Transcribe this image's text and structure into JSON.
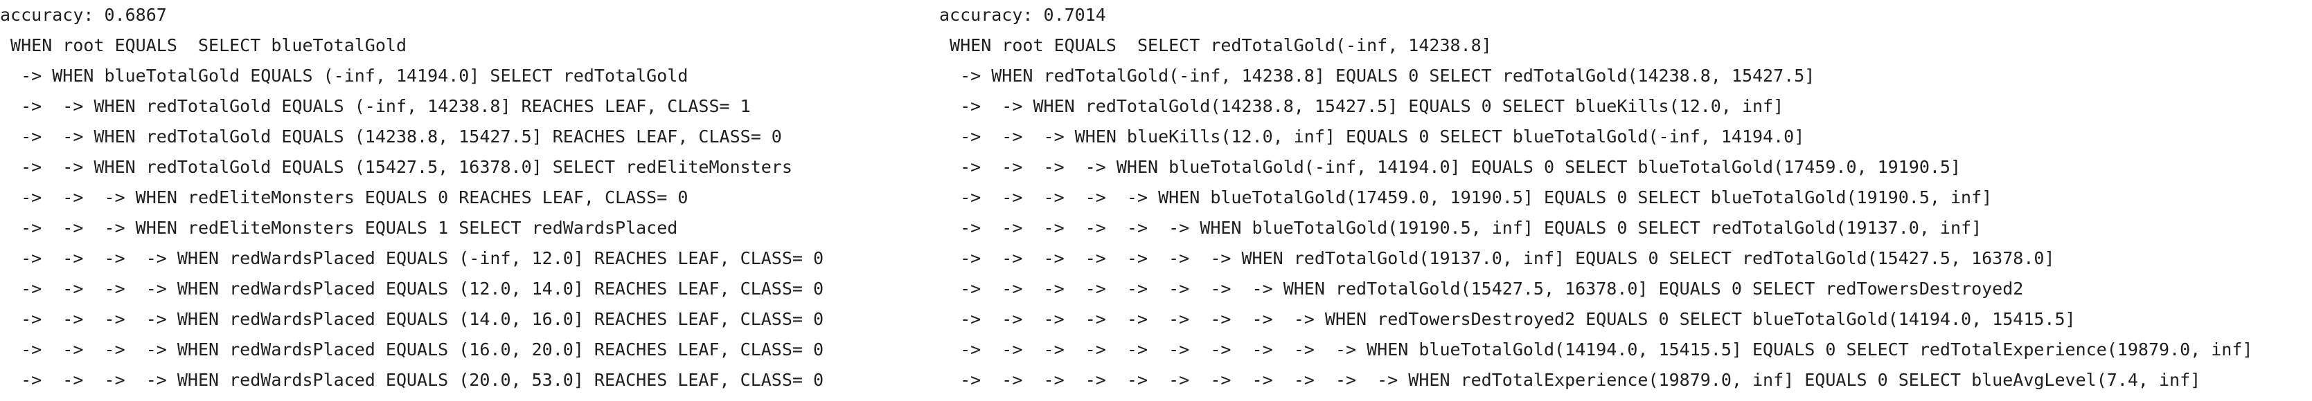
{
  "left_panel": {
    "accuracy": "accuracy: 0.6867",
    "lines": [
      " WHEN root EQUALS  SELECT blueTotalGold",
      "  -> WHEN blueTotalGold EQUALS (-inf, 14194.0] SELECT redTotalGold",
      "  ->  -> WHEN redTotalGold EQUALS (-inf, 14238.8] REACHES LEAF, CLASS= 1",
      "  ->  -> WHEN redTotalGold EQUALS (14238.8, 15427.5] REACHES LEAF, CLASS= 0",
      "  ->  -> WHEN redTotalGold EQUALS (15427.5, 16378.0] SELECT redEliteMonsters",
      "  ->  ->  -> WHEN redEliteMonsters EQUALS 0 REACHES LEAF, CLASS= 0",
      "  ->  ->  -> WHEN redEliteMonsters EQUALS 1 SELECT redWardsPlaced",
      "  ->  ->  ->  -> WHEN redWardsPlaced EQUALS (-inf, 12.0] REACHES LEAF, CLASS= 0",
      "  ->  ->  ->  -> WHEN redWardsPlaced EQUALS (12.0, 14.0] REACHES LEAF, CLASS= 0",
      "  ->  ->  ->  -> WHEN redWardsPlaced EQUALS (14.0, 16.0] REACHES LEAF, CLASS= 0",
      "  ->  ->  ->  -> WHEN redWardsPlaced EQUALS (16.0, 20.0] REACHES LEAF, CLASS= 0",
      "  ->  ->  ->  -> WHEN redWardsPlaced EQUALS (20.0, 53.0] REACHES LEAF, CLASS= 0"
    ]
  },
  "right_panel": {
    "accuracy": "accuracy: 0.7014",
    "lines": [
      " WHEN root EQUALS  SELECT redTotalGold(-inf, 14238.8]",
      "  -> WHEN redTotalGold(-inf, 14238.8] EQUALS 0 SELECT redTotalGold(14238.8, 15427.5]",
      "  ->  -> WHEN redTotalGold(14238.8, 15427.5] EQUALS 0 SELECT blueKills(12.0, inf]",
      "  ->  ->  -> WHEN blueKills(12.0, inf] EQUALS 0 SELECT blueTotalGold(-inf, 14194.0]",
      "  ->  ->  ->  -> WHEN blueTotalGold(-inf, 14194.0] EQUALS 0 SELECT blueTotalGold(17459.0, 19190.5]",
      "  ->  ->  ->  ->  -> WHEN blueTotalGold(17459.0, 19190.5] EQUALS 0 SELECT blueTotalGold(19190.5, inf]",
      "  ->  ->  ->  ->  ->  -> WHEN blueTotalGold(19190.5, inf] EQUALS 0 SELECT redTotalGold(19137.0, inf]",
      "  ->  ->  ->  ->  ->  ->  -> WHEN redTotalGold(19137.0, inf] EQUALS 0 SELECT redTotalGold(15427.5, 16378.0]",
      "  ->  ->  ->  ->  ->  ->  ->  -> WHEN redTotalGold(15427.5, 16378.0] EQUALS 0 SELECT redTowersDestroyed2",
      "  ->  ->  ->  ->  ->  ->  ->  ->  -> WHEN redTowersDestroyed2 EQUALS 0 SELECT blueTotalGold(14194.0, 15415.5]",
      "  ->  ->  ->  ->  ->  ->  ->  ->  ->  -> WHEN blueTotalGold(14194.0, 15415.5] EQUALS 0 SELECT redTotalExperience(19879.0, inf]",
      "  ->  ->  ->  ->  ->  ->  ->  ->  ->  ->  -> WHEN redTotalExperience(19879.0, inf] EQUALS 0 SELECT blueAvgLevel(7.4, inf]"
    ]
  }
}
